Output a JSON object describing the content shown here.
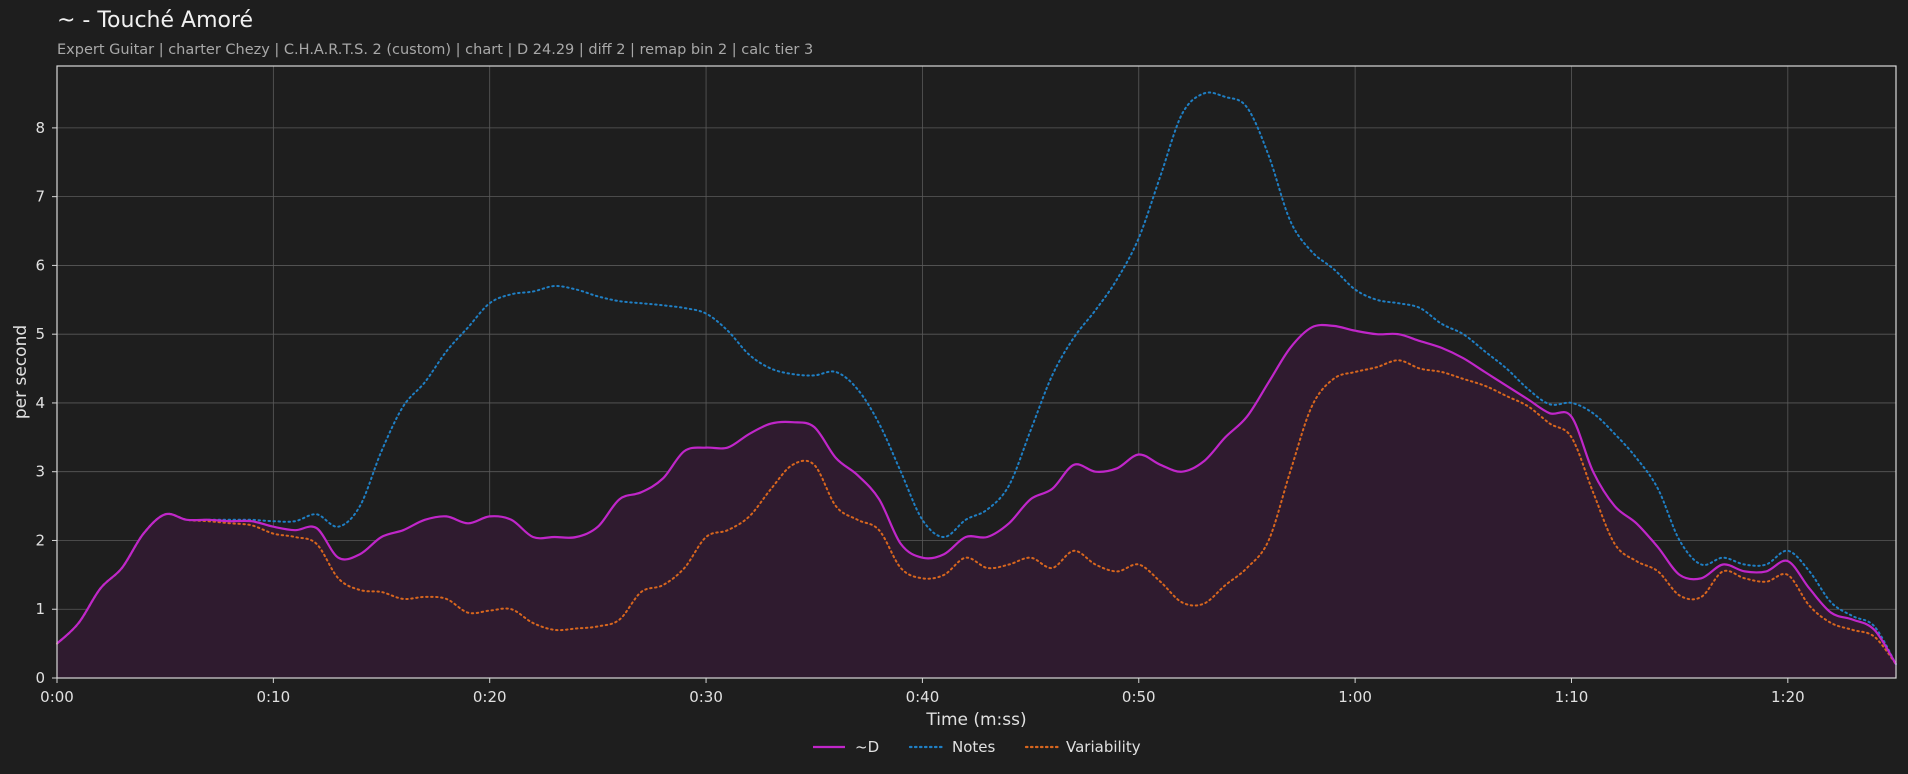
{
  "header": {
    "title": "~ - Touché Amoré",
    "subtitle": "Expert Guitar  |  charter Chezy  |  C.H.A.R.T.S. 2 (custom)  |  chart  |  D 24.29  |  diff 2  |  remap bin 2  |  calc tier 3"
  },
  "colors": {
    "background": "#1e1e1e",
    "d_line": "#c026c9",
    "d_fill": "#2f1b2f",
    "notes": "#1f7fc4",
    "variability": "#d8661e",
    "grid": "#5a5a5a"
  },
  "chart_data": {
    "type": "line",
    "title": "~ - Touché Amoré",
    "xlabel": "Time (m:ss)",
    "ylabel": "per second",
    "xlim": [
      0,
      85
    ],
    "ylim": [
      0,
      8.9
    ],
    "grid": true,
    "legend_position": "bottom-center",
    "x_ticks": [
      {
        "value": 0,
        "label": "0:00"
      },
      {
        "value": 10,
        "label": "0:10"
      },
      {
        "value": 20,
        "label": "0:20"
      },
      {
        "value": 30,
        "label": "0:30"
      },
      {
        "value": 40,
        "label": "0:40"
      },
      {
        "value": 50,
        "label": "0:50"
      },
      {
        "value": 60,
        "label": "1:00"
      },
      {
        "value": 70,
        "label": "1:10"
      },
      {
        "value": 80,
        "label": "1:20"
      }
    ],
    "y_ticks": [
      0,
      1,
      2,
      3,
      4,
      5,
      6,
      7,
      8
    ],
    "series": [
      {
        "name": "~D",
        "style": "solid",
        "filled": true,
        "points": [
          [
            0,
            0.5
          ],
          [
            1,
            0.8
          ],
          [
            2,
            1.3
          ],
          [
            3,
            1.6
          ],
          [
            4,
            2.1
          ],
          [
            5,
            2.38
          ],
          [
            6,
            2.3
          ],
          [
            7,
            2.3
          ],
          [
            8,
            2.28
          ],
          [
            9,
            2.28
          ],
          [
            10,
            2.2
          ],
          [
            11,
            2.15
          ],
          [
            12,
            2.18
          ],
          [
            13,
            1.75
          ],
          [
            14,
            1.8
          ],
          [
            15,
            2.05
          ],
          [
            16,
            2.15
          ],
          [
            17,
            2.3
          ],
          [
            18,
            2.35
          ],
          [
            19,
            2.25
          ],
          [
            20,
            2.35
          ],
          [
            21,
            2.3
          ],
          [
            22,
            2.05
          ],
          [
            23,
            2.05
          ],
          [
            24,
            2.05
          ],
          [
            25,
            2.2
          ],
          [
            26,
            2.6
          ],
          [
            27,
            2.7
          ],
          [
            28,
            2.9
          ],
          [
            29,
            3.3
          ],
          [
            30,
            3.35
          ],
          [
            31,
            3.35
          ],
          [
            32,
            3.55
          ],
          [
            33,
            3.7
          ],
          [
            34,
            3.72
          ],
          [
            35,
            3.65
          ],
          [
            36,
            3.2
          ],
          [
            37,
            2.95
          ],
          [
            38,
            2.6
          ],
          [
            39,
            1.95
          ],
          [
            40,
            1.75
          ],
          [
            41,
            1.8
          ],
          [
            42,
            2.05
          ],
          [
            43,
            2.05
          ],
          [
            44,
            2.25
          ],
          [
            45,
            2.6
          ],
          [
            46,
            2.75
          ],
          [
            47,
            3.1
          ],
          [
            48,
            3.0
          ],
          [
            49,
            3.05
          ],
          [
            50,
            3.25
          ],
          [
            51,
            3.1
          ],
          [
            52,
            3.0
          ],
          [
            53,
            3.15
          ],
          [
            54,
            3.5
          ],
          [
            55,
            3.8
          ],
          [
            56,
            4.3
          ],
          [
            57,
            4.8
          ],
          [
            58,
            5.1
          ],
          [
            59,
            5.12
          ],
          [
            60,
            5.05
          ],
          [
            61,
            5.0
          ],
          [
            62,
            5.0
          ],
          [
            63,
            4.9
          ],
          [
            64,
            4.8
          ],
          [
            65,
            4.65
          ],
          [
            66,
            4.45
          ],
          [
            67,
            4.25
          ],
          [
            68,
            4.05
          ],
          [
            69,
            3.85
          ],
          [
            70,
            3.8
          ],
          [
            71,
            3.0
          ],
          [
            72,
            2.5
          ],
          [
            73,
            2.25
          ],
          [
            74,
            1.9
          ],
          [
            75,
            1.5
          ],
          [
            76,
            1.45
          ],
          [
            77,
            1.65
          ],
          [
            78,
            1.55
          ],
          [
            79,
            1.55
          ],
          [
            80,
            1.7
          ],
          [
            81,
            1.3
          ],
          [
            82,
            0.95
          ],
          [
            83,
            0.85
          ],
          [
            84,
            0.7
          ],
          [
            85,
            0.2
          ]
        ]
      },
      {
        "name": "Notes",
        "style": "dotted",
        "filled": false,
        "points": [
          [
            0,
            0.5
          ],
          [
            1,
            0.8
          ],
          [
            2,
            1.3
          ],
          [
            3,
            1.6
          ],
          [
            4,
            2.1
          ],
          [
            5,
            2.38
          ],
          [
            6,
            2.3
          ],
          [
            7,
            2.3
          ],
          [
            8,
            2.3
          ],
          [
            9,
            2.3
          ],
          [
            10,
            2.28
          ],
          [
            11,
            2.28
          ],
          [
            12,
            2.38
          ],
          [
            13,
            2.2
          ],
          [
            14,
            2.5
          ],
          [
            15,
            3.3
          ],
          [
            16,
            3.95
          ],
          [
            17,
            4.3
          ],
          [
            18,
            4.75
          ],
          [
            19,
            5.1
          ],
          [
            20,
            5.45
          ],
          [
            21,
            5.58
          ],
          [
            22,
            5.62
          ],
          [
            23,
            5.7
          ],
          [
            24,
            5.65
          ],
          [
            25,
            5.55
          ],
          [
            26,
            5.48
          ],
          [
            27,
            5.45
          ],
          [
            28,
            5.42
          ],
          [
            29,
            5.38
          ],
          [
            30,
            5.3
          ],
          [
            31,
            5.05
          ],
          [
            32,
            4.7
          ],
          [
            33,
            4.5
          ],
          [
            34,
            4.42
          ],
          [
            35,
            4.4
          ],
          [
            36,
            4.45
          ],
          [
            37,
            4.2
          ],
          [
            38,
            3.7
          ],
          [
            39,
            3.0
          ],
          [
            40,
            2.3
          ],
          [
            41,
            2.05
          ],
          [
            42,
            2.3
          ],
          [
            43,
            2.45
          ],
          [
            44,
            2.8
          ],
          [
            45,
            3.6
          ],
          [
            46,
            4.4
          ],
          [
            47,
            4.95
          ],
          [
            48,
            5.35
          ],
          [
            49,
            5.8
          ],
          [
            50,
            6.4
          ],
          [
            51,
            7.3
          ],
          [
            52,
            8.2
          ],
          [
            53,
            8.5
          ],
          [
            54,
            8.45
          ],
          [
            55,
            8.3
          ],
          [
            56,
            7.6
          ],
          [
            57,
            6.65
          ],
          [
            58,
            6.2
          ],
          [
            59,
            5.95
          ],
          [
            60,
            5.65
          ],
          [
            61,
            5.5
          ],
          [
            62,
            5.45
          ],
          [
            63,
            5.38
          ],
          [
            64,
            5.15
          ],
          [
            65,
            5.0
          ],
          [
            66,
            4.75
          ],
          [
            67,
            4.5
          ],
          [
            68,
            4.2
          ],
          [
            69,
            3.98
          ],
          [
            70,
            4.0
          ],
          [
            71,
            3.85
          ],
          [
            72,
            3.55
          ],
          [
            73,
            3.2
          ],
          [
            74,
            2.75
          ],
          [
            75,
            2.0
          ],
          [
            76,
            1.65
          ],
          [
            77,
            1.75
          ],
          [
            78,
            1.65
          ],
          [
            79,
            1.65
          ],
          [
            80,
            1.85
          ],
          [
            81,
            1.55
          ],
          [
            82,
            1.1
          ],
          [
            83,
            0.9
          ],
          [
            84,
            0.75
          ],
          [
            85,
            0.2
          ]
        ]
      },
      {
        "name": "Variability",
        "style": "dotted",
        "filled": false,
        "points": [
          [
            0,
            0.5
          ],
          [
            1,
            0.8
          ],
          [
            2,
            1.3
          ],
          [
            3,
            1.6
          ],
          [
            4,
            2.1
          ],
          [
            5,
            2.38
          ],
          [
            6,
            2.3
          ],
          [
            7,
            2.28
          ],
          [
            8,
            2.25
          ],
          [
            9,
            2.22
          ],
          [
            10,
            2.1
          ],
          [
            11,
            2.05
          ],
          [
            12,
            1.95
          ],
          [
            13,
            1.45
          ],
          [
            14,
            1.28
          ],
          [
            15,
            1.25
          ],
          [
            16,
            1.15
          ],
          [
            17,
            1.18
          ],
          [
            18,
            1.15
          ],
          [
            19,
            0.95
          ],
          [
            20,
            0.98
          ],
          [
            21,
            1.0
          ],
          [
            22,
            0.8
          ],
          [
            23,
            0.7
          ],
          [
            24,
            0.72
          ],
          [
            25,
            0.75
          ],
          [
            26,
            0.85
          ],
          [
            27,
            1.25
          ],
          [
            28,
            1.35
          ],
          [
            29,
            1.6
          ],
          [
            30,
            2.05
          ],
          [
            31,
            2.15
          ],
          [
            32,
            2.35
          ],
          [
            33,
            2.75
          ],
          [
            34,
            3.1
          ],
          [
            35,
            3.1
          ],
          [
            36,
            2.5
          ],
          [
            37,
            2.3
          ],
          [
            38,
            2.15
          ],
          [
            39,
            1.6
          ],
          [
            40,
            1.45
          ],
          [
            41,
            1.5
          ],
          [
            42,
            1.75
          ],
          [
            43,
            1.6
          ],
          [
            44,
            1.65
          ],
          [
            45,
            1.75
          ],
          [
            46,
            1.6
          ],
          [
            47,
            1.85
          ],
          [
            48,
            1.65
          ],
          [
            49,
            1.55
          ],
          [
            50,
            1.65
          ],
          [
            51,
            1.4
          ],
          [
            52,
            1.1
          ],
          [
            53,
            1.08
          ],
          [
            54,
            1.35
          ],
          [
            55,
            1.6
          ],
          [
            56,
            2.0
          ],
          [
            57,
            3.0
          ],
          [
            58,
            3.95
          ],
          [
            59,
            4.35
          ],
          [
            60,
            4.45
          ],
          [
            61,
            4.52
          ],
          [
            62,
            4.62
          ],
          [
            63,
            4.5
          ],
          [
            64,
            4.45
          ],
          [
            65,
            4.35
          ],
          [
            66,
            4.25
          ],
          [
            67,
            4.1
          ],
          [
            68,
            3.95
          ],
          [
            69,
            3.7
          ],
          [
            70,
            3.5
          ],
          [
            71,
            2.7
          ],
          [
            72,
            1.95
          ],
          [
            73,
            1.7
          ],
          [
            74,
            1.55
          ],
          [
            75,
            1.2
          ],
          [
            76,
            1.18
          ],
          [
            77,
            1.55
          ],
          [
            78,
            1.45
          ],
          [
            79,
            1.4
          ],
          [
            80,
            1.5
          ],
          [
            81,
            1.05
          ],
          [
            82,
            0.8
          ],
          [
            83,
            0.7
          ],
          [
            84,
            0.6
          ],
          [
            85,
            0.2
          ]
        ]
      }
    ]
  },
  "legend": {
    "d_label": "~D",
    "notes_label": "Notes",
    "variability_label": "Variability"
  }
}
